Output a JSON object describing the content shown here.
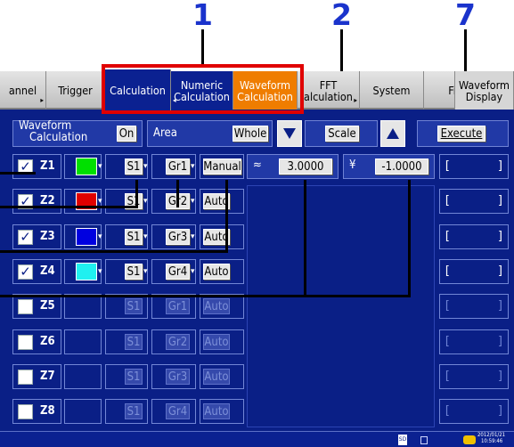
{
  "callouts": [
    "1",
    "2",
    "7"
  ],
  "tabs": {
    "channel": "annel",
    "trigger": "Trigger",
    "calculation": "Calculation",
    "numeric_1": "Numeric",
    "numeric_2": "Calculation",
    "waveform_1": "Waveform",
    "waveform_2": "Calculation",
    "fft_1": "FFT",
    "fft_2": "alculation",
    "system": "System",
    "file": "Fil",
    "waveform_display_1": "Waveform",
    "waveform_display_2": "Display"
  },
  "header": {
    "waveform_calc_1": "Waveform",
    "waveform_calc_2": "Calculation",
    "on_value": "On",
    "area_label": "Area",
    "area_value": "Whole",
    "scale_label": "Scale",
    "execute_label": "Execute"
  },
  "scale": {
    "upper": "3.0000",
    "lower": "-1.0000",
    "upper_icon": "≈",
    "lower_icon": "¥"
  },
  "rows": [
    {
      "label": "Z1",
      "checked": true,
      "color": "#00e000",
      "source": "S1",
      "group": "Gr1",
      "mode": "Manual",
      "enabled": true
    },
    {
      "label": "Z2",
      "checked": true,
      "color": "#e00000",
      "source": "S1",
      "group": "Gr2",
      "mode": "Auto",
      "enabled": true
    },
    {
      "label": "Z3",
      "checked": true,
      "color": "#0000e0",
      "source": "S1",
      "group": "Gr3",
      "mode": "Auto",
      "enabled": true
    },
    {
      "label": "Z4",
      "checked": true,
      "color": "#20f0f0",
      "source": "S1",
      "group": "Gr4",
      "mode": "Auto",
      "enabled": true
    },
    {
      "label": "Z5",
      "checked": false,
      "color": "",
      "source": "S1",
      "group": "Gr1",
      "mode": "Auto",
      "enabled": false
    },
    {
      "label": "Z6",
      "checked": false,
      "color": "",
      "source": "S1",
      "group": "Gr2",
      "mode": "Auto",
      "enabled": false
    },
    {
      "label": "Z7",
      "checked": false,
      "color": "",
      "source": "S1",
      "group": "Gr3",
      "mode": "Auto",
      "enabled": false
    },
    {
      "label": "Z8",
      "checked": false,
      "color": "",
      "source": "S1",
      "group": "Gr4",
      "mode": "Auto",
      "enabled": false
    }
  ],
  "brackets": {
    "open": "[",
    "close": "]"
  },
  "status": {
    "sd_icon": "SD",
    "date": "2012/01/21",
    "time": "10:59:46"
  }
}
